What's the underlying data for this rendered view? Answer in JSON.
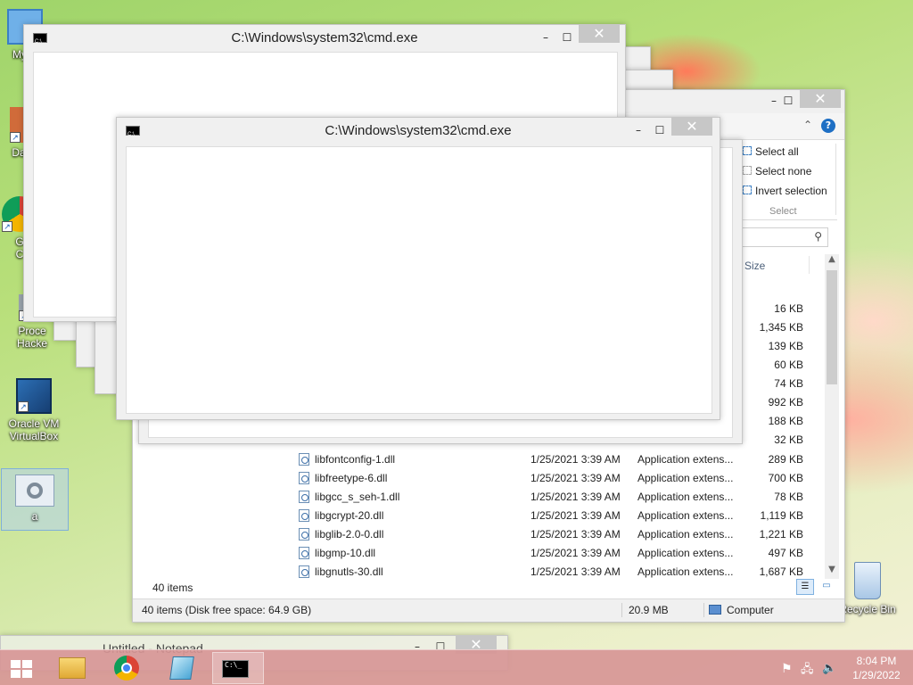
{
  "desktop": {
    "icons": [
      {
        "label": "My C",
        "name": "computer"
      },
      {
        "label": "Data",
        "name": "data"
      },
      {
        "label": "G",
        "label2": "C",
        "name": "chrome"
      },
      {
        "label": "Proce",
        "label2": "Hacke",
        "name": "process-hacker"
      },
      {
        "label": "Oracle VM",
        "label2": "VirtualBox",
        "name": "virtualbox"
      },
      {
        "label": "a",
        "name": "settings-file"
      },
      {
        "label": "Recycle Bin",
        "name": "recycle-bin"
      }
    ]
  },
  "cmd_window_back": {
    "title": "C:\\Windows\\system32\\cmd.exe"
  },
  "cmd_window_front": {
    "title": "C:\\Windows\\system32\\cmd.exe"
  },
  "window_controls": {
    "minimize": "–",
    "maximize": "☐",
    "close": "✕"
  },
  "explorer": {
    "ribbon": {
      "select_all": "Select all",
      "select_none": "Select none",
      "invert_selection": "Invert selection",
      "group_label": "Select"
    },
    "column_size": "Size",
    "sizes_top": [
      "16 KB",
      "1,345 KB",
      "139 KB",
      "60 KB",
      "74 KB",
      "992 KB",
      "188 KB",
      "32 KB"
    ],
    "files": [
      {
        "name": "libfontconfig-1.dll",
        "date": "1/25/2021 3:39 AM",
        "type": "Application extens...",
        "size": "289 KB"
      },
      {
        "name": "libfreetype-6.dll",
        "date": "1/25/2021 3:39 AM",
        "type": "Application extens...",
        "size": "700 KB"
      },
      {
        "name": "libgcc_s_seh-1.dll",
        "date": "1/25/2021 3:39 AM",
        "type": "Application extens...",
        "size": "78 KB"
      },
      {
        "name": "libgcrypt-20.dll",
        "date": "1/25/2021 3:39 AM",
        "type": "Application extens...",
        "size": "1,119 KB"
      },
      {
        "name": "libglib-2.0-0.dll",
        "date": "1/25/2021 3:39 AM",
        "type": "Application extens...",
        "size": "1,221 KB"
      },
      {
        "name": "libgmp-10.dll",
        "date": "1/25/2021 3:39 AM",
        "type": "Application extens...",
        "size": "497 KB"
      },
      {
        "name": "libgnutls-30.dll",
        "date": "1/25/2021 3:39 AM",
        "type": "Application extens...",
        "size": "1,687 KB"
      }
    ],
    "items_count": "40 items",
    "status_left": "40 items (Disk free space: 64.9 GB)",
    "status_size": "20.9 MB",
    "status_location": "Computer"
  },
  "notepad": {
    "title": "Untitled - Notepad"
  },
  "taskbar": {
    "apps": [
      "start",
      "file-explorer",
      "chrome",
      "notepad",
      "cmd"
    ],
    "time": "8:04 PM",
    "date": "1/29/2022"
  }
}
